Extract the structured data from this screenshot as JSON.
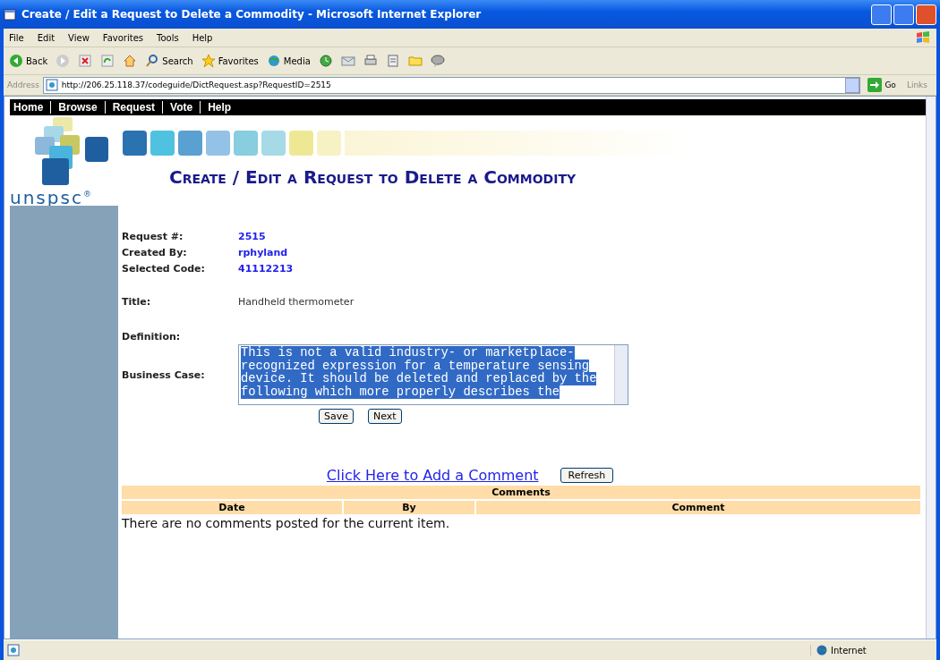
{
  "window": {
    "title": "Create / Edit a Request to Delete a Commodity - Microsoft Internet Explorer"
  },
  "menu_bar": [
    "File",
    "Edit",
    "View",
    "Favorites",
    "Tools",
    "Help"
  ],
  "toolbar": [
    {
      "kind": "back",
      "label": "Back"
    },
    {
      "kind": "forward"
    },
    {
      "kind": "stop"
    },
    {
      "kind": "refresh"
    },
    {
      "kind": "home"
    },
    {
      "kind": "search",
      "label": "Search"
    },
    {
      "kind": "favorites",
      "label": "Favorites"
    },
    {
      "kind": "media",
      "label": "Media"
    },
    {
      "kind": "history"
    },
    {
      "kind": "mail"
    },
    {
      "kind": "print"
    },
    {
      "kind": "edit"
    },
    {
      "kind": "folder"
    },
    {
      "kind": "messenger"
    }
  ],
  "address_bar": {
    "label": "Address",
    "url": "http://206.25.118.37/codeguide/DictRequest.asp?RequestID=2515",
    "go": "Go",
    "links": "Links"
  },
  "nav": [
    "Home",
    "Browse",
    "Request",
    "Vote",
    "Help"
  ],
  "logo": {
    "text": "unspsc$^{®}$"
  },
  "heading": "Create / Edit a Request to Delete a Commodity",
  "info": [
    {
      "label": "Request #:",
      "value": "2515"
    },
    {
      "label": "Created By:",
      "value": "rphyland"
    },
    {
      "label": "Selected Code:",
      "value": "41112213"
    }
  ],
  "title_field": {
    "label": "Title:",
    "value": "Handheld thermometer"
  },
  "definition": {
    "label": "Definition:"
  },
  "business_case": {
    "label": "Business Case:",
    "value": "This is not a valid industry- or marketplace-recognized expression for a temperature sensing device.  It should be deleted and replaced by the following which more properly describes the",
    "selected": true
  },
  "buttons": [
    "Save",
    "Next"
  ],
  "add_comment_link": "Click Here to Add a Comment",
  "refresh_button": "Refresh",
  "comments": {
    "title": "Comments",
    "columns": [
      "Date",
      "By",
      "Comment"
    ],
    "empty_message": "There are no comments posted for the current item."
  },
  "status_bar": {
    "zone": "Internet"
  }
}
